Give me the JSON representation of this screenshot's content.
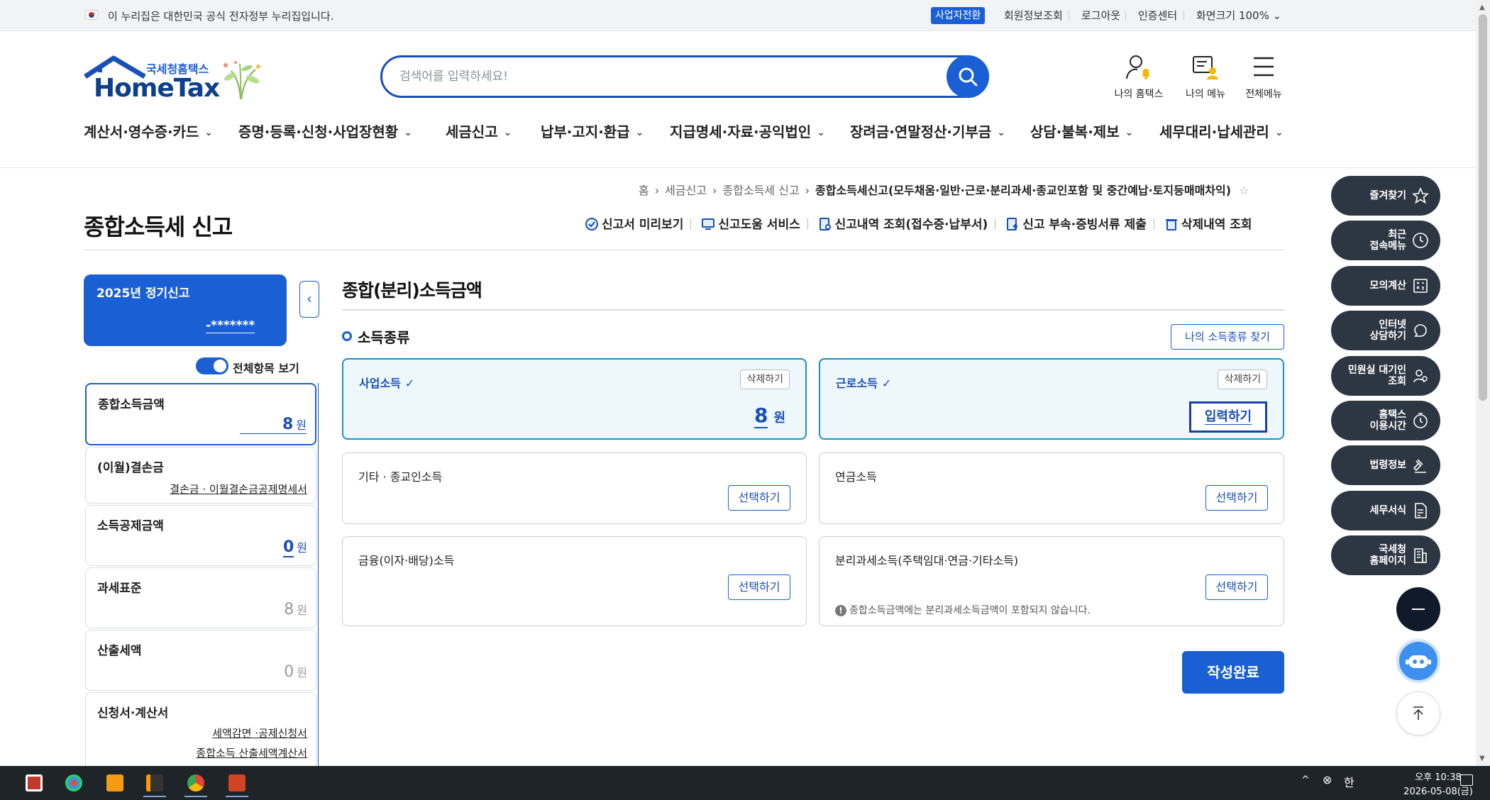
{
  "govbar": {
    "text": "이 누리집은 대한민국 공식 전자정부 누리집입니다.",
    "biz_switch": "사업자전환",
    "member_info": "회원정보조회",
    "logout": "로그아웃",
    "cert_center": "인증센터",
    "screen_size": "화면크기 100% ⌄"
  },
  "header": {
    "logo_small": "국세청홈택스",
    "logo_big": "HomeTax",
    "search_placeholder": "검색어를 입력하세요!",
    "my_hometax": "나의 홈택스",
    "my_menu": "나의 메뉴",
    "all_menu": "전체메뉴"
  },
  "nav": [
    "계산서·영수증·카드",
    "증명·등록·신청·사업장현황",
    "세금신고",
    "납부·고지·환급",
    "지급명세·자료·공익법인",
    "장려금·연말정산·기부금",
    "상담·불복·제보",
    "세무대리·납세관리"
  ],
  "breadcrumb": {
    "home": "홈",
    "level1": "세금신고",
    "level2": "종합소득세 신고",
    "current": "종합소득세신고(모두채움·일반·근로·분리과세·종교인포함 및 중간예납·토지등매매차익)"
  },
  "page_title": "종합소득세 신고",
  "tools": [
    "신고서 미리보기",
    "신고도움 서비스",
    "신고내역 조회(접수증·납부서)",
    "신고 부속·증빙서류 제출",
    "삭제내역 조회"
  ],
  "left": {
    "year_label": "2025년 정기신고",
    "masked_id": "-*******",
    "toggle_label": "전체항목 보기",
    "items": [
      {
        "title": "종합소득금액",
        "value": "8",
        "unit": "원"
      },
      {
        "title": "(이월)결손금",
        "link": "결손금 · 이월결손금공제명세서"
      },
      {
        "title": "소득공제금액",
        "value": "0",
        "unit": "원"
      },
      {
        "title": "과세표준",
        "value": "8",
        "unit": "원"
      },
      {
        "title": "산출세액",
        "value": "0",
        "unit": "원"
      },
      {
        "title": "신청서·계산서",
        "link1": "세액감면 ·공제신청서",
        "link2": "종합소득 산출세액계산서"
      }
    ]
  },
  "main": {
    "section_title": "종합(분리)소득금액",
    "subhead": "소득종류",
    "find_button": "나의 소득종류 찾기",
    "check_mark": "✓",
    "cards": {
      "business": {
        "title": "사업소득",
        "delete": "삭제하기",
        "amount": "8",
        "unit": "원"
      },
      "wage": {
        "title": "근로소득",
        "delete": "삭제하기",
        "input": "입력하기"
      },
      "other": {
        "title": "기타 · 종교인소득",
        "select": "선택하기"
      },
      "pension": {
        "title": "연금소득",
        "select": "선택하기"
      },
      "finance": {
        "title": "금융(이자·배당)소득",
        "select": "선택하기"
      },
      "separate": {
        "title": "분리과세소득(주택임대·연금·기타소득)",
        "select": "선택하기",
        "note": "종합소득금액에는 분리과세소득금액이 포함되지 않습니다."
      }
    },
    "done_button": "작성완료"
  },
  "quick_menu": [
    {
      "label": "즐겨찾기",
      "icon": "star-icon"
    },
    {
      "label": "최근\n접속메뉴",
      "icon": "clock-icon"
    },
    {
      "label": "모의계산",
      "icon": "calculator-icon"
    },
    {
      "label": "인터넷\n상담하기",
      "icon": "chat-icon"
    },
    {
      "label": "민원실 대기인\n조회",
      "icon": "people-icon"
    },
    {
      "label": "홈택스\n이용시간",
      "icon": "clock-icon"
    },
    {
      "label": "법령정보",
      "icon": "gavel-icon"
    },
    {
      "label": "세무서식",
      "icon": "document-icon"
    },
    {
      "label": "국세청\n홈페이지",
      "icon": "building-icon"
    }
  ],
  "taskbar": {
    "time": "오후 10:38",
    "date": "2026-05-08(금)"
  },
  "colors": {
    "primary": "#1a5fd4",
    "dark": "#2d3744",
    "selected_card_border": "#1e8fc6"
  }
}
